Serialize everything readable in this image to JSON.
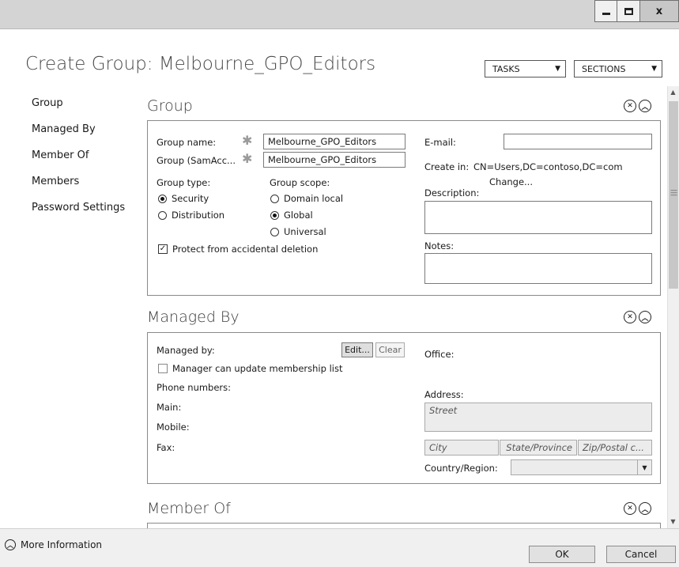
{
  "window": {
    "close_glyph": "x"
  },
  "header": {
    "title": "Create Group: Melbourne_GPO_Editors",
    "tasks_label": "TASKS",
    "sections_label": "SECTIONS",
    "dropdown_arrow": "▼"
  },
  "nav": {
    "items": [
      {
        "label": "Group"
      },
      {
        "label": "Managed By"
      },
      {
        "label": "Member Of"
      },
      {
        "label": "Members"
      },
      {
        "label": "Password Settings"
      }
    ]
  },
  "group": {
    "title": "Group",
    "name_label": "Group name:",
    "name_value": "Melbourne_GPO_Editors",
    "sam_label": "Group (SamAcc...",
    "sam_value": "Melbourne_GPO_Editors",
    "required_mark": "✱",
    "type_label": "Group type:",
    "type_options": [
      {
        "label": "Security",
        "selected": true
      },
      {
        "label": "Distribution",
        "selected": false
      }
    ],
    "scope_label": "Group scope:",
    "scope_options": [
      {
        "label": "Domain local",
        "selected": false
      },
      {
        "label": "Global",
        "selected": true
      },
      {
        "label": "Universal",
        "selected": false
      }
    ],
    "protect_label": "Protect from accidental deletion",
    "protect_checked": true,
    "email_label": "E-mail:",
    "email_value": "",
    "create_in_label": "Create in:",
    "create_in_value": "CN=Users,DC=contoso,DC=com",
    "change_link": "Change...",
    "description_label": "Description:",
    "notes_label": "Notes:"
  },
  "managed_by": {
    "title": "Managed By",
    "managed_by_label": "Managed by:",
    "edit_label": "Edit...",
    "clear_label": "Clear",
    "manager_update_label": "Manager can update membership list",
    "manager_update_checked": false,
    "phone_numbers_label": "Phone numbers:",
    "main_label": "Main:",
    "mobile_label": "Mobile:",
    "fax_label": "Fax:",
    "office_label": "Office:",
    "address_label": "Address:",
    "street_placeholder": "Street",
    "city_placeholder": "City",
    "state_placeholder": "State/Province",
    "zip_placeholder": "Zip/Postal c...",
    "country_label": "Country/Region:",
    "country_value": ""
  },
  "member_of": {
    "title": "Member Of"
  },
  "footer": {
    "more_info_label": "More Information",
    "ok_label": "OK",
    "cancel_label": "Cancel"
  }
}
